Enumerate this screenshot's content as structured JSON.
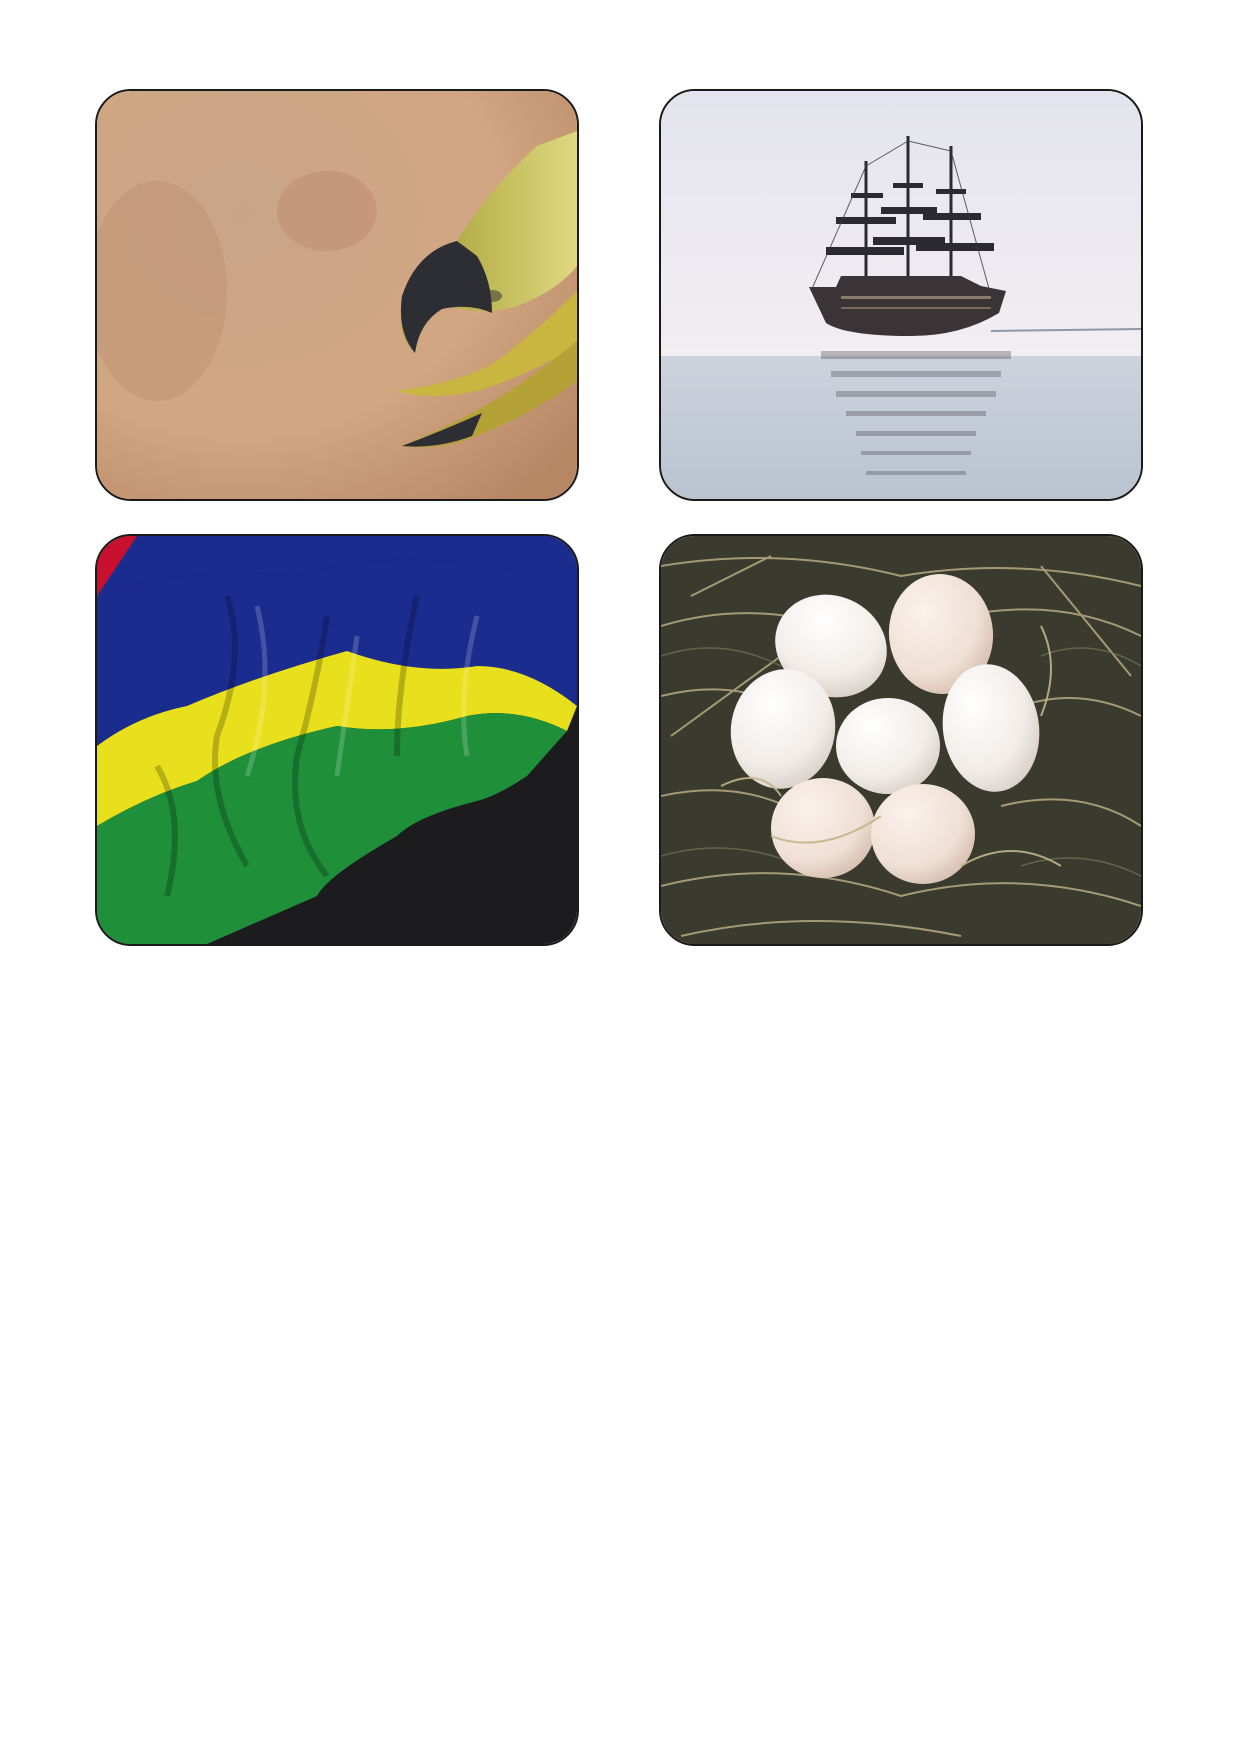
{
  "cards": [
    {
      "id": "dodo",
      "subject": "dodo-beak-picture"
    },
    {
      "id": "ship",
      "subject": "sailing-ship-picture"
    },
    {
      "id": "flag",
      "subject": "mauritius-flag-picture"
    },
    {
      "id": "eggs",
      "subject": "eggs-in-nest-picture"
    }
  ],
  "flag": {
    "colors": [
      "#c8102e",
      "#1b2c8f",
      "#e8e01c",
      "#1f8f3a"
    ]
  }
}
